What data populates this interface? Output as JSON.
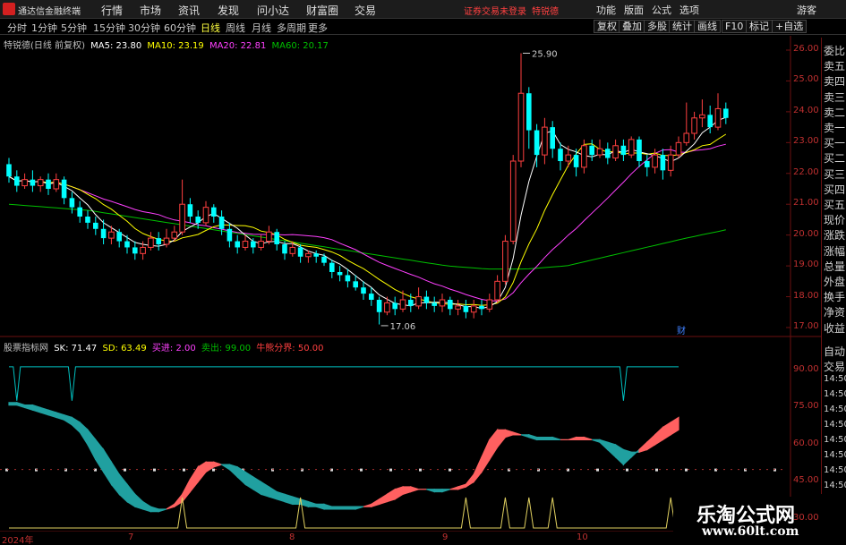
{
  "app": {
    "title": "通达信金融终端"
  },
  "menu": [
    "行情",
    "市场",
    "资讯",
    "发现",
    "问小达",
    "财富圈",
    "交易"
  ],
  "notice": {
    "text1": "证券交易未登录",
    "text2": "特锐德"
  },
  "right_menu": [
    "功能",
    "版面",
    "公式",
    "选项",
    "游客"
  ],
  "periods": [
    "分时",
    "1分钟",
    "5分钟",
    "15分钟",
    "30分钟",
    "60分钟",
    "日线",
    "周线",
    "月线",
    "多周期",
    "更多"
  ],
  "active_period": "日线",
  "toolbar": [
    "复权",
    "叠加",
    "多股",
    "统计",
    "画线",
    "F10",
    "标记",
    "+自选"
  ],
  "kline_info": {
    "name": "特锐德(日线 前复权)",
    "ma5": "MA5: 23.80",
    "ma10": "MA10: 23.19",
    "ma20": "MA20: 22.81",
    "ma60": "MA60: 20.17"
  },
  "indicator_info": {
    "name": "股票指标网",
    "sk": "SK: 71.47",
    "sd": "SD: 63.49",
    "buy": "买进: 2.00",
    "sell": "卖出: 99.00",
    "bull": "牛熊分界: 50.00"
  },
  "right_panel": [
    "委比",
    "卖五",
    "卖四",
    "卖三",
    "卖二",
    "卖一",
    "买一",
    "买二",
    "买三",
    "买四",
    "买五",
    "现价",
    "涨跌",
    "涨幅",
    "总量",
    "外盘",
    "换手",
    "净资",
    "收益"
  ],
  "right_panel2": [
    "自动",
    "交易",
    "14:50",
    "14:50",
    "14:50",
    "14:50",
    "14:50",
    "14:50",
    "14:50",
    "14:50",
    "14:50"
  ],
  "price_axis": [
    "26.00",
    "25.00",
    "24.00",
    "23.00",
    "22.00",
    "21.00",
    "20.00",
    "19.00",
    "18.00",
    "17.00"
  ],
  "ind_axis": [
    "90.00",
    "75.00",
    "60.00",
    "45.00",
    "30.00"
  ],
  "time_axis": [
    "2024年",
    "7",
    "8",
    "9",
    "10"
  ],
  "annotations": {
    "high": "25.90",
    "low": "17.06",
    "marker": "财"
  },
  "colors": {
    "up": "#ff4040",
    "down": "#00ffff",
    "ma5": "#ffffff",
    "ma10": "#ffff00",
    "ma20": "#ff40ff",
    "ma60": "#00c000"
  },
  "chart_data": {
    "type": "candlestick",
    "title": "特锐德(日线 前复权)",
    "price_range": [
      17.0,
      26.0
    ],
    "high_label": 25.9,
    "low_label": 17.06,
    "ma_values": {
      "MA5": 23.8,
      "MA10": 23.19,
      "MA20": 22.81,
      "MA60": 20.17
    },
    "candles": [
      [
        22.3,
        21.9,
        22.5,
        21.7
      ],
      [
        21.9,
        21.6,
        22.1,
        21.4
      ],
      [
        21.6,
        21.8,
        22.0,
        21.5
      ],
      [
        21.8,
        21.6,
        22.1,
        21.4
      ],
      [
        21.6,
        21.8,
        21.9,
        21.4
      ],
      [
        21.8,
        21.5,
        22.0,
        21.3
      ],
      [
        21.5,
        21.8,
        22.0,
        21.4
      ],
      [
        21.8,
        21.2,
        21.9,
        21.0
      ],
      [
        21.2,
        20.9,
        21.4,
        20.7
      ],
      [
        20.9,
        20.6,
        21.1,
        20.4
      ],
      [
        20.6,
        20.4,
        20.8,
        20.2
      ],
      [
        20.4,
        20.2,
        20.6,
        20.0
      ],
      [
        20.2,
        19.9,
        20.5,
        19.7
      ],
      [
        19.9,
        20.1,
        20.3,
        19.7
      ],
      [
        20.1,
        19.8,
        20.2,
        19.6
      ],
      [
        19.8,
        19.6,
        20.0,
        19.4
      ],
      [
        19.6,
        19.4,
        19.8,
        19.2
      ],
      [
        19.4,
        19.6,
        19.8,
        19.2
      ],
      [
        19.6,
        19.9,
        20.1,
        19.5
      ],
      [
        19.9,
        19.7,
        20.1,
        19.5
      ],
      [
        19.7,
        19.9,
        20.2,
        19.6
      ],
      [
        19.9,
        20.1,
        20.3,
        19.8
      ],
      [
        20.1,
        21.0,
        21.8,
        20.0
      ],
      [
        21.0,
        20.6,
        21.2,
        20.4
      ],
      [
        20.6,
        20.4,
        20.8,
        20.2
      ],
      [
        20.4,
        20.9,
        21.1,
        20.3
      ],
      [
        20.9,
        20.6,
        21.0,
        20.4
      ],
      [
        20.6,
        20.2,
        20.8,
        20.0
      ],
      [
        20.2,
        19.8,
        20.4,
        19.6
      ],
      [
        19.8,
        19.6,
        20.0,
        19.4
      ],
      [
        19.6,
        19.8,
        20.0,
        19.5
      ],
      [
        19.8,
        19.6,
        19.9,
        19.4
      ],
      [
        19.6,
        19.8,
        20.0,
        19.5
      ],
      [
        19.8,
        20.1,
        20.3,
        19.7
      ],
      [
        20.1,
        19.7,
        20.2,
        19.5
      ],
      [
        19.7,
        19.4,
        19.8,
        19.2
      ],
      [
        19.4,
        19.6,
        19.8,
        19.3
      ],
      [
        19.6,
        19.3,
        19.7,
        19.1
      ],
      [
        19.3,
        19.4,
        19.5,
        19.1
      ],
      [
        19.4,
        19.3,
        19.5,
        19.1
      ],
      [
        19.3,
        19.1,
        19.4,
        19.0
      ],
      [
        19.1,
        18.8,
        19.2,
        18.6
      ],
      [
        18.8,
        18.7,
        19.0,
        18.5
      ],
      [
        18.7,
        18.5,
        18.9,
        18.3
      ],
      [
        18.5,
        18.3,
        18.7,
        18.2
      ],
      [
        18.3,
        18.1,
        18.5,
        17.9
      ],
      [
        18.1,
        17.9,
        18.3,
        17.7
      ],
      [
        17.9,
        17.5,
        18.0,
        17.1
      ],
      [
        17.5,
        17.8,
        18.0,
        17.4
      ],
      [
        17.8,
        17.6,
        18.0,
        17.4
      ],
      [
        17.6,
        17.9,
        18.2,
        17.5
      ],
      [
        17.9,
        17.7,
        18.1,
        17.5
      ],
      [
        17.7,
        18.0,
        18.3,
        17.6
      ],
      [
        18.0,
        17.8,
        18.2,
        17.6
      ],
      [
        17.8,
        17.7,
        18.0,
        17.5
      ],
      [
        17.7,
        17.9,
        18.1,
        17.5
      ],
      [
        17.9,
        17.6,
        18.0,
        17.4
      ],
      [
        17.6,
        17.7,
        17.9,
        17.4
      ],
      [
        17.7,
        17.5,
        17.9,
        17.3
      ],
      [
        17.5,
        17.7,
        17.9,
        17.3
      ],
      [
        17.7,
        17.6,
        17.9,
        17.4
      ],
      [
        17.6,
        17.9,
        18.1,
        17.5
      ],
      [
        17.9,
        18.5,
        18.7,
        17.8
      ],
      [
        18.5,
        19.8,
        20.0,
        18.4
      ],
      [
        19.8,
        22.4,
        22.6,
        19.7
      ],
      [
        22.4,
        24.6,
        25.9,
        22.2
      ],
      [
        24.6,
        23.4,
        24.8,
        22.8
      ],
      [
        23.4,
        22.6,
        23.6,
        22.2
      ],
      [
        22.6,
        23.5,
        23.8,
        22.3
      ],
      [
        23.5,
        22.8,
        23.7,
        22.5
      ],
      [
        22.8,
        22.4,
        23.0,
        22.1
      ],
      [
        22.4,
        22.6,
        22.9,
        22.2
      ],
      [
        22.6,
        22.2,
        22.8,
        21.9
      ],
      [
        22.2,
        22.9,
        23.1,
        22.0
      ],
      [
        22.9,
        22.6,
        23.1,
        22.4
      ],
      [
        22.6,
        22.8,
        23.1,
        22.5
      ],
      [
        22.8,
        22.5,
        23.0,
        22.3
      ],
      [
        22.5,
        22.9,
        23.1,
        22.4
      ],
      [
        22.9,
        22.6,
        23.1,
        22.4
      ],
      [
        22.6,
        23.1,
        23.2,
        22.5
      ],
      [
        23.1,
        22.4,
        23.2,
        22.2
      ],
      [
        22.4,
        22.2,
        22.6,
        21.9
      ],
      [
        22.2,
        22.6,
        22.8,
        22.0
      ],
      [
        22.6,
        22.1,
        22.8,
        21.8
      ],
      [
        22.1,
        22.6,
        22.9,
        21.9
      ],
      [
        22.6,
        23.0,
        23.2,
        22.5
      ],
      [
        23.0,
        23.3,
        24.3,
        22.9
      ],
      [
        23.3,
        23.8,
        24.0,
        23.1
      ],
      [
        23.8,
        23.9,
        24.4,
        23.5
      ],
      [
        23.9,
        23.5,
        24.2,
        23.3
      ],
      [
        23.5,
        24.1,
        24.6,
        23.4
      ],
      [
        24.1,
        23.8,
        24.3,
        23.6
      ]
    ],
    "indicator": {
      "name": "股票指标网",
      "range": [
        30,
        95
      ],
      "sk": [
        76,
        76,
        75,
        74,
        73,
        72,
        71,
        70,
        68,
        65,
        60,
        54,
        49,
        44,
        40,
        37,
        35,
        34,
        33,
        33,
        34,
        36,
        40,
        46,
        51,
        53,
        53,
        52,
        50,
        47,
        44,
        42,
        40,
        39,
        38,
        37,
        36,
        36,
        35,
        35,
        34,
        34,
        34,
        34,
        34,
        35,
        36,
        38,
        40,
        42,
        43,
        43,
        42,
        42,
        41,
        41,
        42,
        43,
        44,
        48,
        55,
        62,
        66,
        66,
        65,
        64,
        63,
        62,
        62,
        62,
        62,
        62,
        63,
        63,
        62,
        61,
        58,
        55,
        52,
        55,
        58,
        61,
        64,
        67,
        69,
        71
      ],
      "sd": [
        77,
        77,
        76,
        76,
        75,
        74,
        73,
        72,
        71,
        69,
        66,
        62,
        58,
        53,
        48,
        44,
        40,
        37,
        35,
        34,
        34,
        35,
        37,
        41,
        45,
        49,
        51,
        52,
        52,
        51,
        49,
        47,
        45,
        43,
        41,
        40,
        39,
        38,
        37,
        36,
        36,
        35,
        35,
        35,
        35,
        35,
        35,
        36,
        37,
        38,
        40,
        41,
        42,
        42,
        42,
        42,
        42,
        42,
        43,
        45,
        49,
        54,
        59,
        63,
        64,
        64,
        64,
        63,
        63,
        63,
        62,
        62,
        62,
        62,
        62,
        62,
        61,
        60,
        58,
        57,
        57,
        58,
        60,
        62,
        64,
        66
      ],
      "sell_signals": [
        1,
        8,
        78
      ],
      "buy_signals": [
        22,
        37,
        58,
        63,
        66,
        69,
        84
      ]
    }
  }
}
